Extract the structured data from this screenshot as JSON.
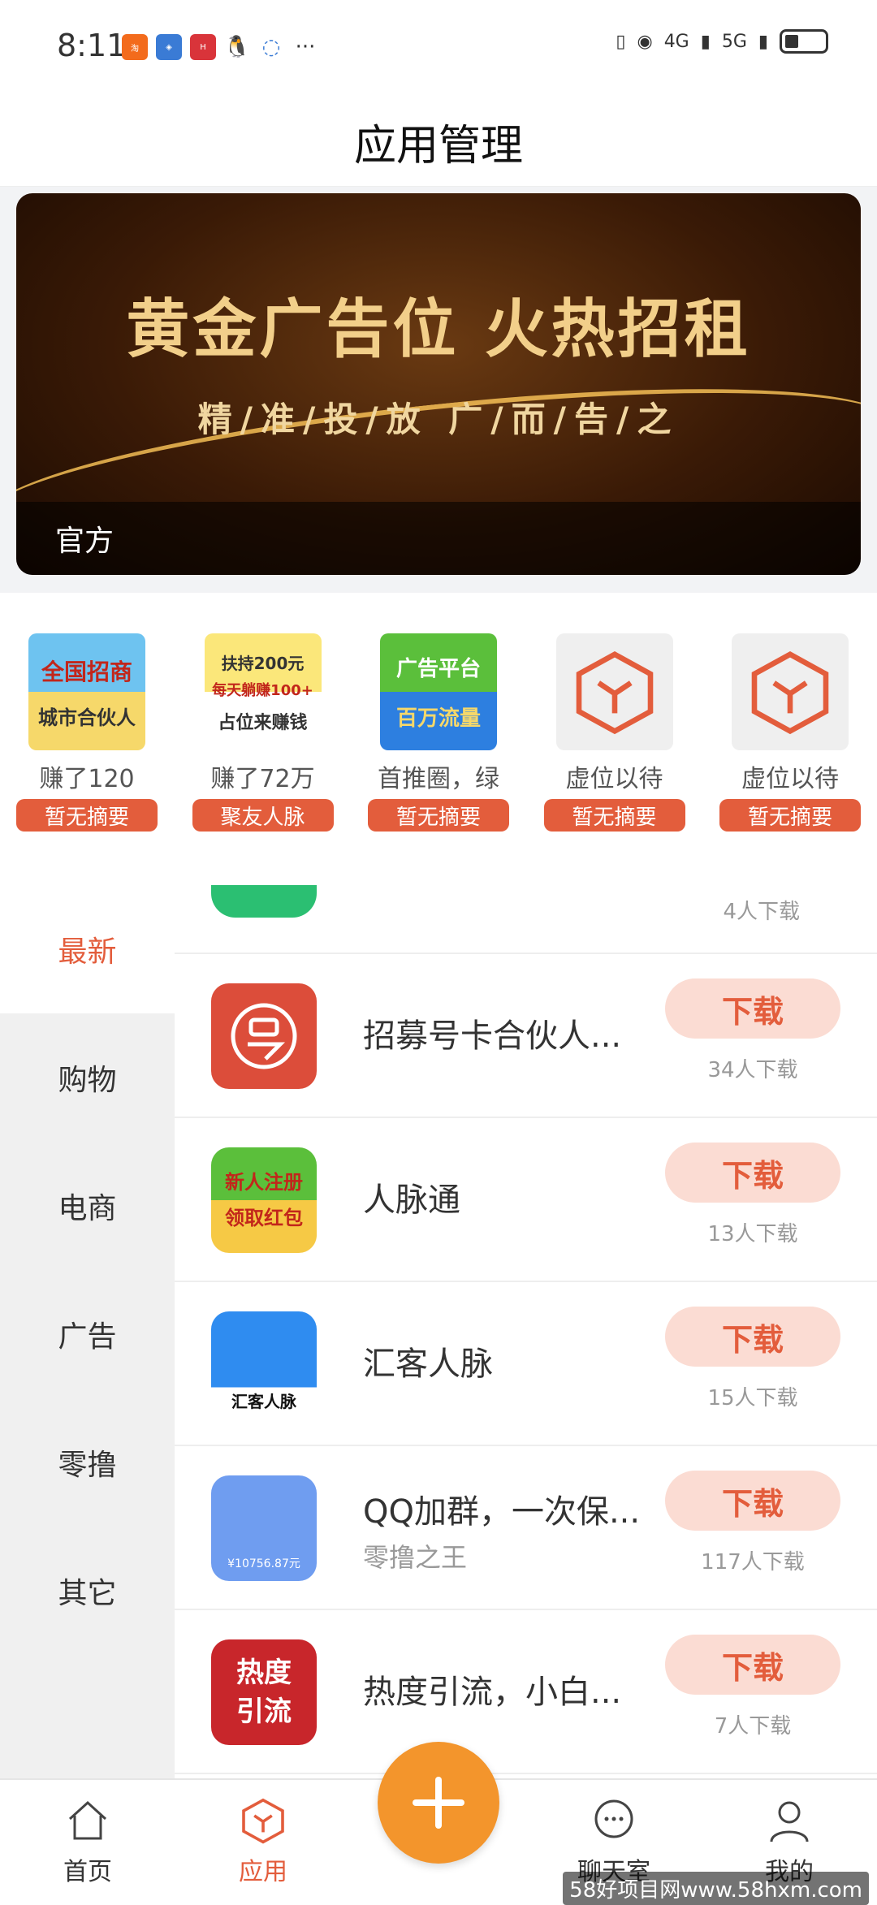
{
  "status_bar": {
    "time": "8:11",
    "network_1": "4G",
    "network_2": "5G",
    "notif_icons": [
      "taobao-icon",
      "security-icon",
      "huawei-icon",
      "qq-icon",
      "message-icon"
    ]
  },
  "header": {
    "title": "应用管理"
  },
  "banner": {
    "headline": "黄金广告位 火热招租",
    "subline": "精/准/投/放  广/而/告/之",
    "caption": "官方"
  },
  "promos": [
    {
      "thumb_line1": "全国招商",
      "thumb_line2": "城市合伙人",
      "name": "赚了120",
      "tag": "暂无摘要"
    },
    {
      "thumb_line1": "扶持200元",
      "thumb_line2": "每天躺赚100+",
      "thumb_line3": "占位来赚钱",
      "name": "赚了72万",
      "tag": "聚友人脉"
    },
    {
      "thumb_line1": "广告平台",
      "thumb_line2": "百万流量",
      "name": "首推圈，绿",
      "tag": "暂无摘要"
    },
    {
      "name": "虚位以待",
      "tag": "暂无摘要"
    },
    {
      "name": "虚位以待",
      "tag": "暂无摘要"
    }
  ],
  "categories": [
    "最新",
    "购物",
    "电商",
    "广告",
    "零撸",
    "其它"
  ],
  "partial_app": {
    "downloads": "4人下载"
  },
  "apps": [
    {
      "name": "招募号卡合伙人...",
      "sub": "",
      "button": "下载",
      "downloads": "34人下载",
      "icon_text": ""
    },
    {
      "name": "人脉通",
      "sub": "",
      "button": "下载",
      "downloads": "13人下载",
      "icon_text": "新人注册 领取红包"
    },
    {
      "name": "汇客人脉",
      "sub": "",
      "button": "下载",
      "downloads": "15人下载",
      "icon_text": "汇客人脉"
    },
    {
      "name": "QQ加群，一次保...",
      "sub": "零撸之王",
      "button": "下载",
      "downloads": "117人下载",
      "icon_text": "¥10756.87元"
    },
    {
      "name": "热度引流，小白...",
      "sub": "",
      "button": "下载",
      "downloads": "7人下载",
      "icon_text": "热度引流"
    }
  ],
  "bottom_nav": [
    {
      "label": "首页",
      "icon": "home-icon"
    },
    {
      "label": "应用",
      "icon": "box-icon"
    },
    {
      "label": "聊天室",
      "icon": "chat-icon"
    },
    {
      "label": "我的",
      "icon": "user-icon"
    }
  ],
  "watermark": "58好项目网www.58hxm.com",
  "colors": {
    "accent": "#e35d3c",
    "fab": "#f3952c"
  }
}
